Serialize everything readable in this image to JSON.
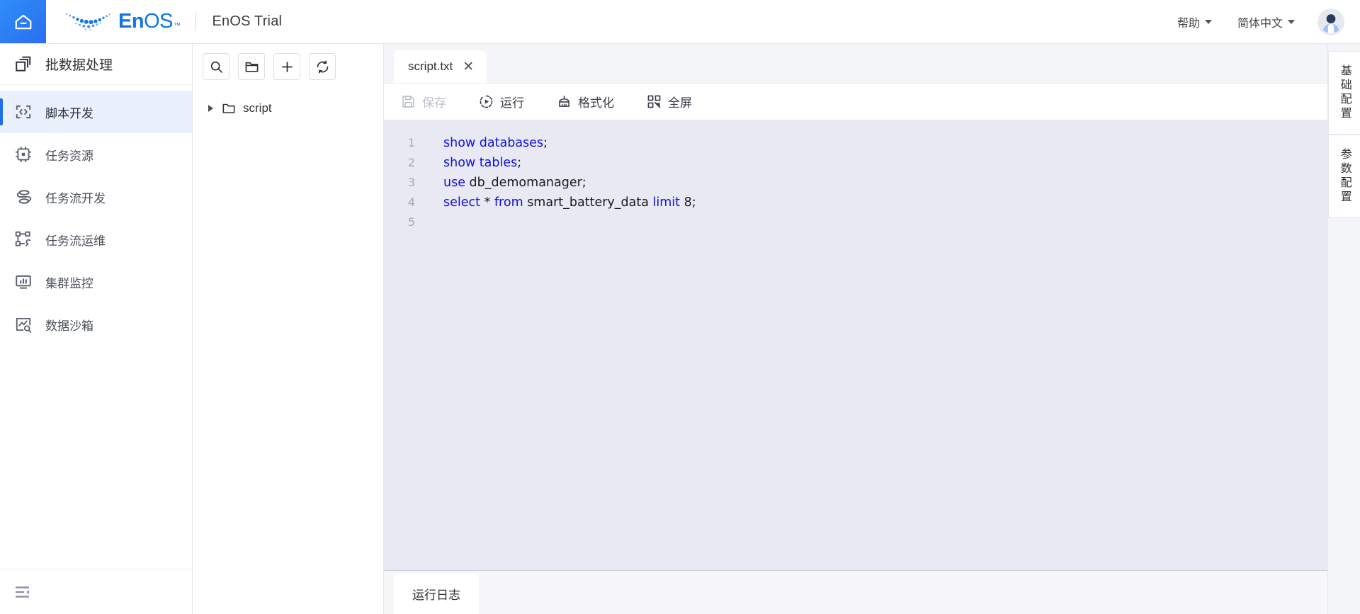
{
  "header": {
    "home_icon": "home-icon",
    "logo_en": "En",
    "logo_os": "OS",
    "logo_tm": "™",
    "tenant": "EnOS Trial",
    "help_label": "帮助",
    "language_label": "简体中文",
    "avatar": "user-avatar"
  },
  "sidebar": {
    "title": "批数据处理",
    "title_icon": "batch-data-icon",
    "items": [
      {
        "label": "脚本开发",
        "icon": "code-brackets-icon",
        "active": true
      },
      {
        "label": "任务资源",
        "icon": "chip-icon",
        "active": false
      },
      {
        "label": "任务流开发",
        "icon": "flow-icon",
        "active": false
      },
      {
        "label": "任务流运维",
        "icon": "flow-ops-icon",
        "active": false
      },
      {
        "label": "集群监控",
        "icon": "monitor-icon",
        "active": false
      },
      {
        "label": "数据沙箱",
        "icon": "sandbox-icon",
        "active": false
      }
    ],
    "collapse_icon": "collapse-menu-icon"
  },
  "file_panel": {
    "tools": [
      {
        "name": "search-icon",
        "title": "搜索"
      },
      {
        "name": "new-folder-icon",
        "title": "新建文件夹"
      },
      {
        "name": "plus-icon",
        "title": "新建"
      },
      {
        "name": "refresh-icon",
        "title": "刷新"
      }
    ],
    "tree": [
      {
        "label": "script",
        "icon": "folder-icon",
        "expanded": false
      }
    ]
  },
  "editor": {
    "tabs": [
      {
        "label": "script.txt",
        "close": "✕",
        "active": true
      }
    ],
    "toolbar": [
      {
        "label": "保存",
        "icon": "save-icon",
        "disabled": true
      },
      {
        "label": "运行",
        "icon": "run-icon",
        "disabled": false
      },
      {
        "label": "格式化",
        "icon": "format-icon",
        "disabled": false
      },
      {
        "label": "全屏",
        "icon": "fullscreen-icon",
        "disabled": false
      }
    ],
    "lines": [
      {
        "no": "1",
        "tokens": [
          {
            "t": "show ",
            "k": "kw"
          },
          {
            "t": "databases",
            "k": "kw"
          },
          {
            "t": ";",
            "k": "pun"
          }
        ]
      },
      {
        "no": "2",
        "tokens": [
          {
            "t": "show ",
            "k": "kw"
          },
          {
            "t": "tables",
            "k": "kw"
          },
          {
            "t": ";",
            "k": "pun"
          }
        ]
      },
      {
        "no": "3",
        "tokens": [
          {
            "t": "use",
            "k": "kw"
          },
          {
            "t": " db_demomanager;",
            "k": "pun"
          }
        ]
      },
      {
        "no": "4",
        "tokens": [
          {
            "t": "select",
            "k": "kw"
          },
          {
            "t": " * ",
            "k": "pun"
          },
          {
            "t": "from",
            "k": "kw"
          },
          {
            "t": " smart_battery_data ",
            "k": "pun"
          },
          {
            "t": "limit",
            "k": "kw"
          },
          {
            "t": " 8;",
            "k": "pun"
          }
        ]
      },
      {
        "no": "5",
        "tokens": []
      }
    ],
    "plain_code": "show databases;\nshow tables;\nuse db_demomanager;\nselect * from smart_battery_data limit 8;\n"
  },
  "bottom": {
    "tabs": [
      {
        "label": "运行日志",
        "active": true
      }
    ]
  },
  "right_rail": {
    "items": [
      {
        "label": "基础配置"
      },
      {
        "label": "参数配置"
      }
    ]
  },
  "colors": {
    "brand_blue": "#1573e6",
    "accent_active": "#1f6fe5",
    "nav_active_bg": "#eaf1fd",
    "editor_bg": "#e8e9f2",
    "keyword": "#1111dd",
    "tabstrip_bg": "#f4f5f8"
  }
}
